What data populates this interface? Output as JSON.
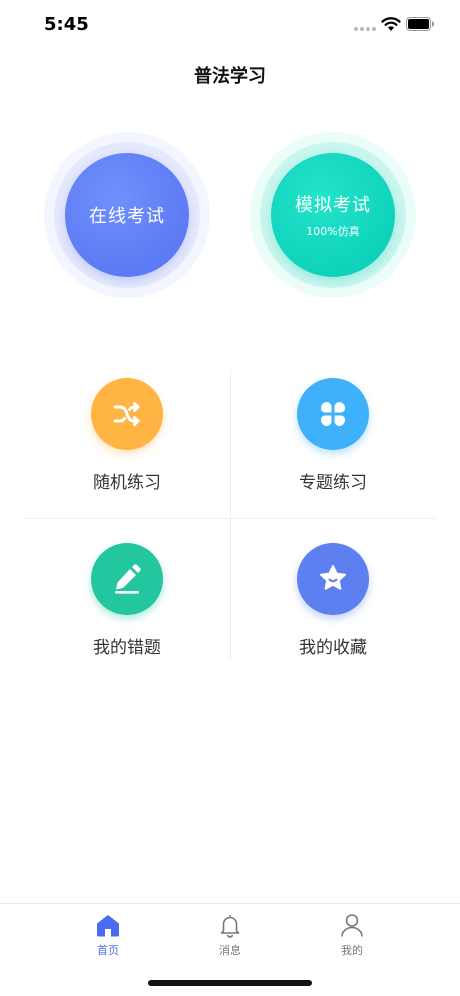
{
  "status_bar": {
    "time": "5:45"
  },
  "nav": {
    "title": "普法学习"
  },
  "exams": {
    "online": {
      "label": "在线考试"
    },
    "mock": {
      "label": "模拟考试",
      "sub": "100%仿真"
    }
  },
  "practice": [
    {
      "label": "随机练习",
      "icon": "shuffle-icon",
      "color": "#ffb443"
    },
    {
      "label": "专题练习",
      "icon": "grid-icon",
      "color": "#3fb0fa"
    },
    {
      "label": "我的错题",
      "icon": "pencil-icon",
      "color": "#22c69f"
    },
    {
      "label": "我的收藏",
      "icon": "star-icon",
      "color": "#5e7ff0"
    }
  ],
  "tabs": [
    {
      "label": "首页",
      "icon": "home-icon",
      "active": true
    },
    {
      "label": "消息",
      "icon": "bell-icon",
      "active": false
    },
    {
      "label": "我的",
      "icon": "user-icon",
      "active": false
    }
  ],
  "colors": {
    "accent": "#4a6cf1",
    "online": "#5e7ff5",
    "mock": "#10d4bd"
  }
}
